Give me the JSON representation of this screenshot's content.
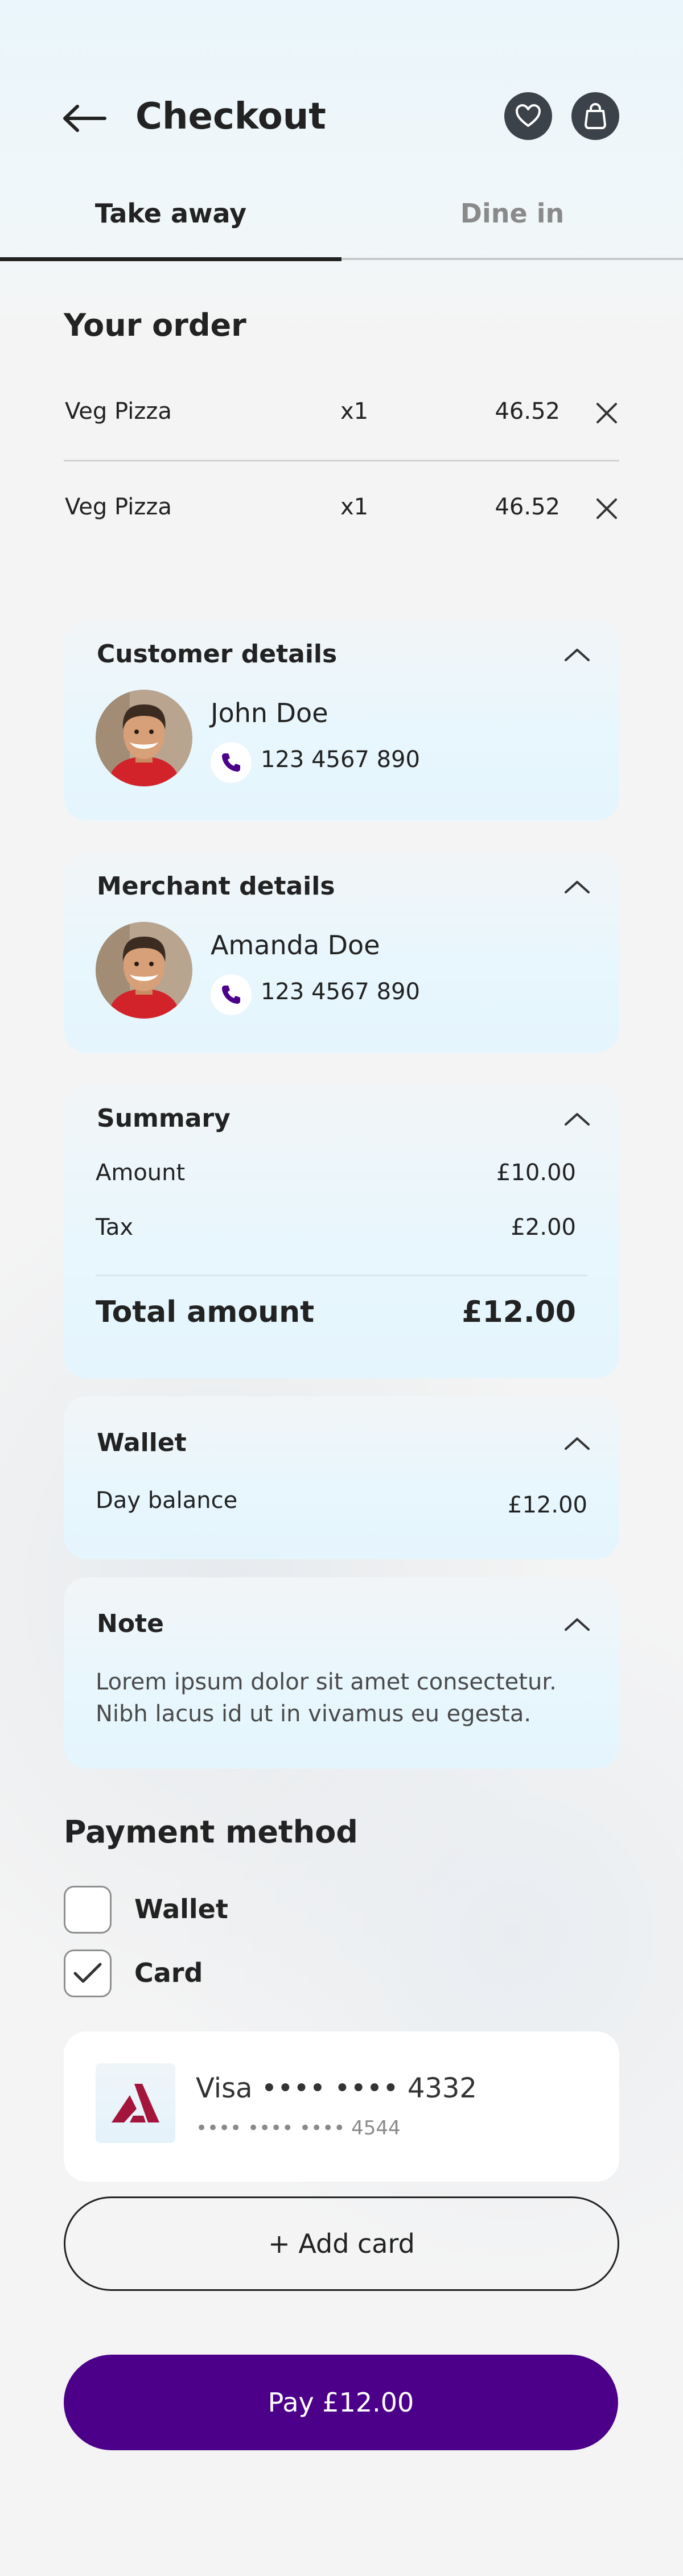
{
  "header": {
    "title": "Checkout",
    "back_icon": "arrow-left-icon",
    "favorite_icon": "heart-icon",
    "bag_icon": "shopping-bag-icon"
  },
  "tabs": [
    {
      "label": "Take away",
      "active": true
    },
    {
      "label": "Dine in",
      "active": false
    }
  ],
  "order": {
    "title": "Your order",
    "items": [
      {
        "name": "Veg Pizza",
        "qty": "x1",
        "price": "46.52"
      },
      {
        "name": "Veg Pizza",
        "qty": "x1",
        "price": "46.52"
      }
    ]
  },
  "customer": {
    "title": "Customer details",
    "name": "John Doe",
    "phone": "123 4567 890"
  },
  "merchant": {
    "title": "Merchant details",
    "name": "Amanda Doe",
    "phone": "123 4567 890"
  },
  "summary": {
    "title": "Summary",
    "amount_label": "Amount",
    "amount_value": "£10.00",
    "tax_label": "Tax",
    "tax_value": "£2.00",
    "total_label": "Total amount",
    "total_value": "£12.00"
  },
  "wallet": {
    "title": "Wallet",
    "balance_label": "Day balance",
    "balance_value": "£12.00"
  },
  "note": {
    "title": "Note",
    "text": "Lorem ipsum dolor sit amet consectetur. Nibh lacus id ut in vivamus eu egesta."
  },
  "payment": {
    "title": "Payment method",
    "options": [
      {
        "label": "Wallet",
        "checked": false
      },
      {
        "label": "Card",
        "checked": true
      }
    ],
    "saved_card": {
      "title": "Visa •••• •••• 4332",
      "subtitle": "•••• •••• •••• 4544"
    },
    "add_card_label": "+ Add card",
    "pay_label": "Pay £12.00"
  },
  "colors": {
    "primary": "#4c008a",
    "phone_icon": "#4c008a",
    "bank_logo": "#a3153a",
    "dark_button": "#3b4249"
  }
}
